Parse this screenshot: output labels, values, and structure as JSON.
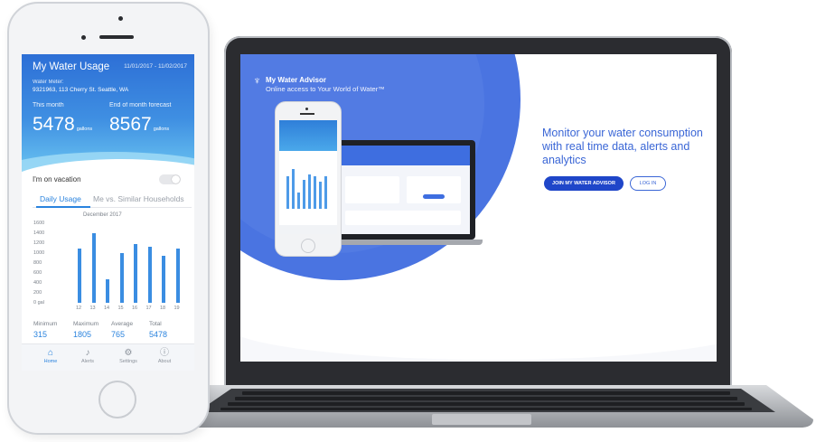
{
  "phone": {
    "header": {
      "title": "My Water Usage",
      "date_range": "11/01/2017 - 11/02/2017",
      "meter_label": "Water Meter:",
      "meter_address": "9321963, 113 Cherry St. Seattle, WA",
      "this_month_label": "This month",
      "this_month_value": "5478",
      "forecast_label": "End of month forecast",
      "forecast_value": "8567",
      "unit": "gallons"
    },
    "vacation_label": "I'm on vacation",
    "tabs": [
      "Daily Usage",
      "Me vs. Similar Households"
    ],
    "chart": {
      "title": "December 2017",
      "y_ticks": [
        "1600",
        "1400",
        "1200",
        "1000",
        "800",
        "600",
        "400",
        "200",
        "0 gal"
      ]
    },
    "stats": [
      {
        "label": "Minimum",
        "value": "315"
      },
      {
        "label": "Maximum",
        "value": "1805"
      },
      {
        "label": "Average",
        "value": "765"
      },
      {
        "label": "Total",
        "value": "5478"
      }
    ],
    "nav": [
      {
        "label": "Home",
        "icon": "home-icon"
      },
      {
        "label": "Alerts",
        "icon": "bell-icon"
      },
      {
        "label": "Settings",
        "icon": "gear-icon"
      },
      {
        "label": "About",
        "icon": "info-icon"
      }
    ]
  },
  "chart_data": {
    "type": "bar",
    "title": "December 2017",
    "categories": [
      "12",
      "13",
      "14",
      "15",
      "16",
      "17",
      "18",
      "19"
    ],
    "values": [
      1100,
      1400,
      480,
      1000,
      1180,
      1130,
      950,
      1100
    ],
    "ylim": [
      0,
      1600
    ],
    "ylabel": "",
    "xlabel": ""
  },
  "laptop": {
    "brand_title": "My Water Advisor",
    "brand_tagline": "Online access to Your World of Water™",
    "headline": "Monitor your water consumption with real time data, alerts and analytics",
    "join_button": "JOIN MY WATER ADVISOR",
    "login_button": "LOG IN"
  },
  "colors": {
    "primary_blue": "#2a83de",
    "brand_blue": "#4a74e1",
    "button_blue": "#1f46c9"
  }
}
